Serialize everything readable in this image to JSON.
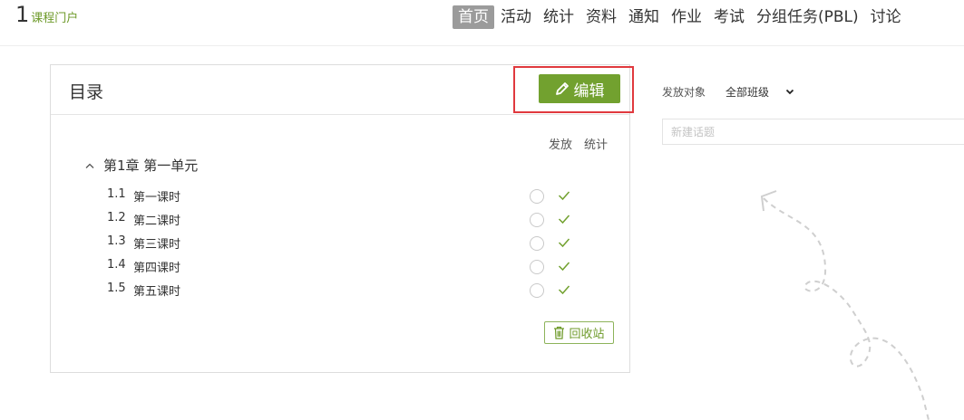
{
  "header": {
    "logo_number": "1",
    "logo_text": "课程门户",
    "nav": [
      "首页",
      "活动",
      "统计",
      "资料",
      "通知",
      "作业",
      "考试",
      "分组任务(PBL)",
      "讨论"
    ],
    "active_nav": "首页"
  },
  "catalog": {
    "title": "目录",
    "edit_label": "编辑",
    "col_publish": "发放",
    "col_stats": "统计",
    "chapter": "第1章  第一单元",
    "lessons": [
      {
        "num": "1.1",
        "title": "第一课时"
      },
      {
        "num": "1.2",
        "title": "第二课时"
      },
      {
        "num": "1.3",
        "title": "第三课时"
      },
      {
        "num": "1.4",
        "title": "第四课时"
      },
      {
        "num": "1.5",
        "title": "第五课时"
      }
    ],
    "recycle_label": "回收站"
  },
  "discussion": {
    "target_label": "发放对象",
    "target_value": "全部班级",
    "topic_placeholder": "新建话题"
  },
  "colors": {
    "accent": "#72a12f",
    "highlight": "#e0393e",
    "active_nav_bg": "#9b9b9b"
  },
  "icons": [
    "pencil-icon",
    "chevron-up-icon",
    "checkmark-icon",
    "trash-icon",
    "chevron-down-icon"
  ]
}
